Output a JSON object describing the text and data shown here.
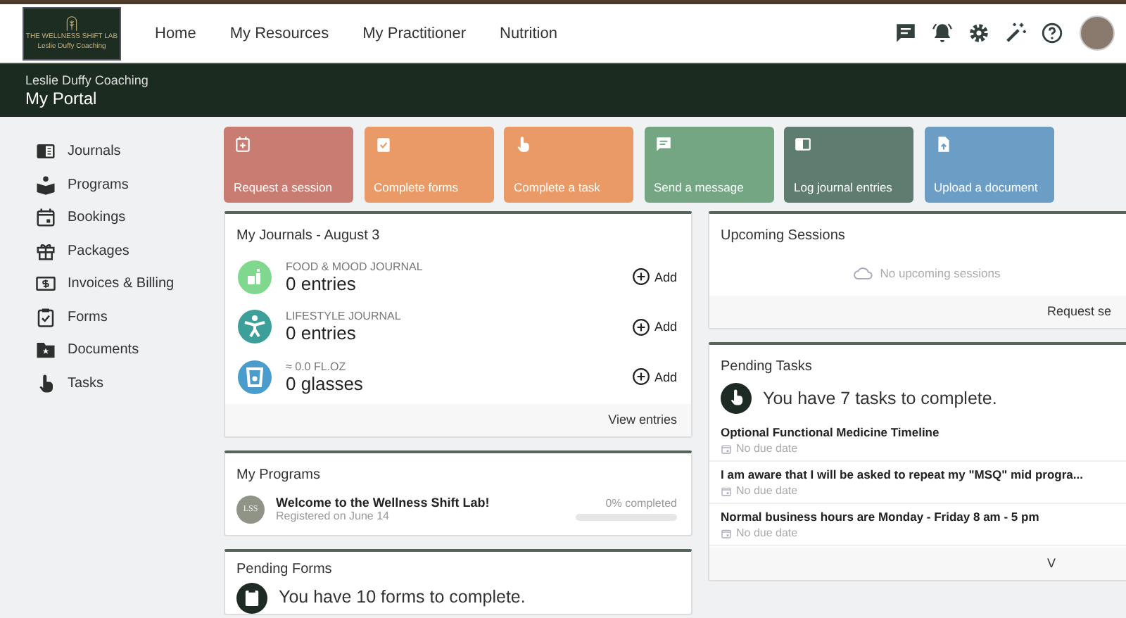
{
  "header": {
    "logo": {
      "title": "THE WELLNESS SHIFT LAB",
      "subtitle": "Leslie Duffy Coaching"
    },
    "nav": [
      {
        "label": "Home"
      },
      {
        "label": "My Resources"
      },
      {
        "label": "My Practitioner"
      },
      {
        "label": "Nutrition"
      }
    ]
  },
  "banner": {
    "org": "Leslie Duffy Coaching",
    "title": "My Portal"
  },
  "sidebar": {
    "items": [
      {
        "label": "Journals"
      },
      {
        "label": "Programs"
      },
      {
        "label": "Bookings"
      },
      {
        "label": "Packages"
      },
      {
        "label": "Invoices & Billing"
      },
      {
        "label": "Forms"
      },
      {
        "label": "Documents"
      },
      {
        "label": "Tasks"
      }
    ]
  },
  "tiles": [
    {
      "label": "Request a session",
      "color": "#c97c72"
    },
    {
      "label": "Complete forms",
      "color": "#e99a67"
    },
    {
      "label": "Complete a task",
      "color": "#e99a67"
    },
    {
      "label": "Send a message",
      "color": "#74a684"
    },
    {
      "label": "Log journal entries",
      "color": "#5e7c6f"
    },
    {
      "label": "Upload a document",
      "color": "#6c9dc5"
    }
  ],
  "journals": {
    "title": "My Journals - August 3",
    "rows": [
      {
        "category": "FOOD & MOOD JOURNAL",
        "count": "0 entries",
        "color": "#7fd88d",
        "add": "Add"
      },
      {
        "category": "LIFESTYLE JOURNAL",
        "count": "0 entries",
        "color": "#3d9f99",
        "add": "Add"
      },
      {
        "category": "≈ 0.0 FL.OZ",
        "count": "0 glasses",
        "color": "#4a9ccd",
        "add": "Add"
      }
    ],
    "footer": "View entries"
  },
  "programs": {
    "title": "My Programs",
    "items": [
      {
        "badge": "LSS",
        "name": "Welcome to the Wellness Shift Lab!",
        "registered": "Registered on June 14",
        "progress_text": "0% completed",
        "level": 0
      }
    ]
  },
  "pending_forms": {
    "title": "Pending Forms",
    "message": "You have 10 forms to complete."
  },
  "upcoming_sessions": {
    "title": "Upcoming Sessions",
    "empty_text": "No upcoming sessions",
    "footer": "Request se"
  },
  "pending_tasks": {
    "title": "Pending Tasks",
    "message": "You have 7 tasks to complete.",
    "items": [
      {
        "title": "Optional Functional Medicine Timeline",
        "due": "No due date"
      },
      {
        "title": "I am aware that I will be asked to repeat my \"MSQ\" mid progra...",
        "due": "No due date"
      },
      {
        "title": "Normal business hours are Monday - Friday 8 am - 5 pm",
        "due": "No due date"
      }
    ],
    "footer": "V"
  }
}
